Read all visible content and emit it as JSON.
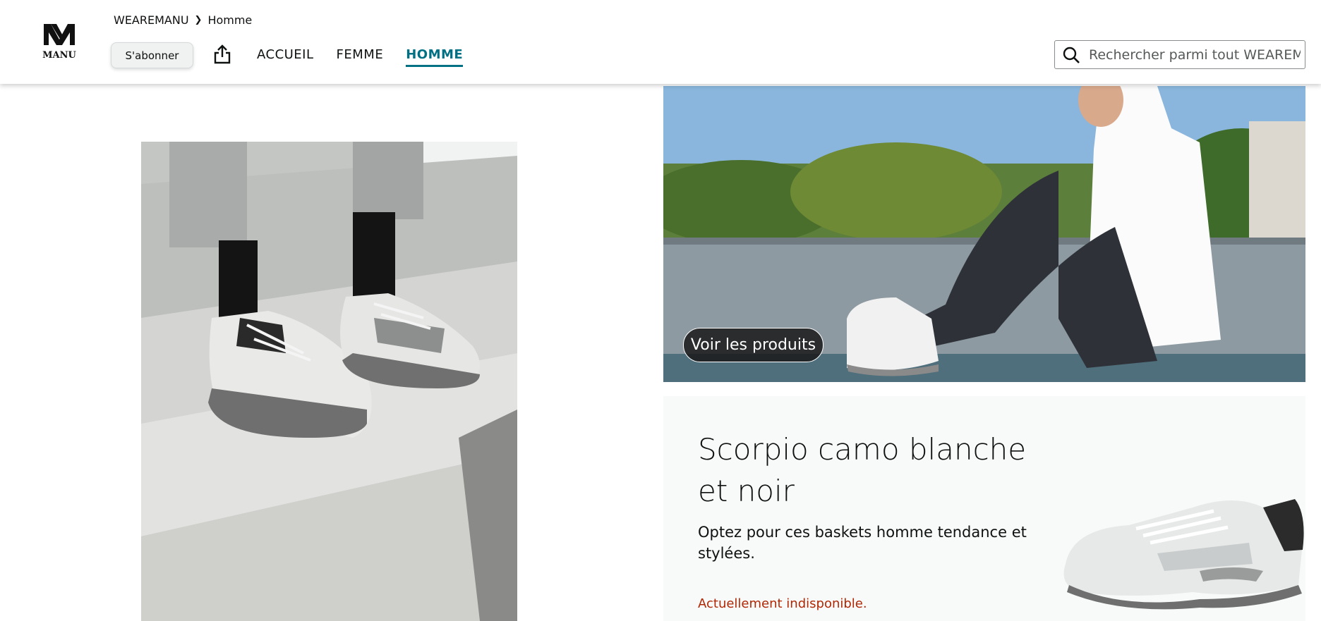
{
  "header": {
    "logo_icon": "wearemanu-logo",
    "logo_text": "MANU",
    "breadcrumb": [
      "WEAREMANU",
      "Homme"
    ],
    "subscribe_label": "S'abonner",
    "share_icon": "share-icon",
    "nav": [
      {
        "label": "ACCUEIL",
        "active": false
      },
      {
        "label": "FEMME",
        "active": false
      },
      {
        "label": "HOMME",
        "active": true
      }
    ],
    "search": {
      "placeholder": "Rechercher parmi tout WEAREMANU",
      "icon": "search-icon"
    }
  },
  "hero": {
    "left_image": "sneakers-on-concrete-step-photo",
    "right_image": "man-sitting-wearing-sneakers-photo",
    "products_button_label": "Voir les produits"
  },
  "product": {
    "title": "Scorpio camo blanche et noir",
    "description": "Optez pour ces baskets homme tendance et stylées.",
    "availability": "Actuellement indisponible.",
    "image": "white-sneaker-product-photo"
  },
  "colors": {
    "accent": "#007185",
    "unavailable": "#b12704",
    "card_background": "#f8fafa"
  }
}
